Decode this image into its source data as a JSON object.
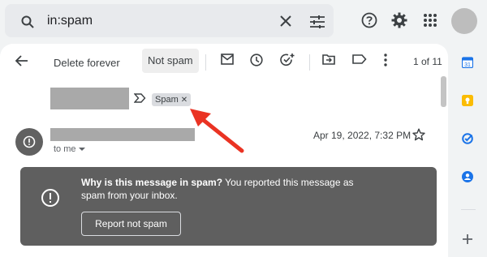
{
  "search": {
    "query": "in:spam"
  },
  "toolbar": {
    "delete_forever": "Delete forever",
    "not_spam": "Not spam",
    "page_count": "1 of 11"
  },
  "message": {
    "label_chip": "Spam",
    "to": "to me",
    "date": "Apr 19, 2022, 7:32 PM"
  },
  "spam_banner": {
    "question": "Why is this message in spam?",
    "explanation": " You reported this message as spam from your inbox.",
    "button": "Report not spam"
  },
  "colors": {
    "annotation_arrow": "#ea3323",
    "banner_bg": "#5f5f5f",
    "calendar_icon": "#1a73e8",
    "keep_icon": "#fbbc04",
    "tasks_icon": "#1a73e8",
    "contacts_icon": "#1a73e8"
  },
  "icons": {
    "search": "search-icon",
    "clear": "close-icon",
    "filters": "tune-icon",
    "help": "help-icon",
    "settings": "gear-icon",
    "apps": "apps-grid-icon",
    "back": "arrow-back-icon",
    "mark_unread": "envelope-icon",
    "snooze": "clock-icon",
    "add_task": "add-task-icon",
    "move_to": "move-to-folder-icon",
    "label": "label-icon",
    "more": "more-vert-icon",
    "important_marker": "importance-marker-icon",
    "star": "star-icon",
    "spam_warning": "alert-circle-icon"
  }
}
